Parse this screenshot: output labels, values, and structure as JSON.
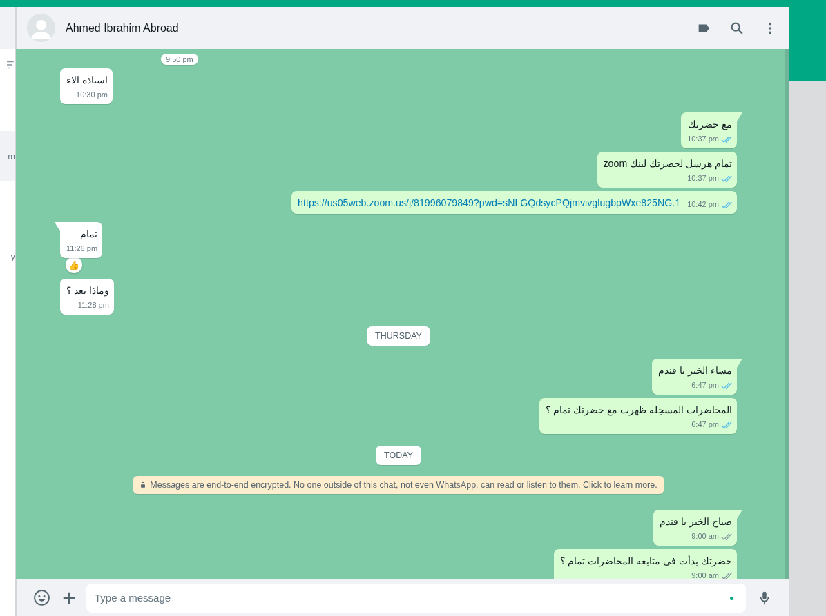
{
  "sidebar": {
    "items": [
      {
        "text": "m",
        "selected": true
      },
      {
        "text": "y",
        "selected": false
      }
    ]
  },
  "chat": {
    "contact_name": "Ahmed Ibrahim Abroad"
  },
  "messages": [
    {
      "kind": "cut",
      "time": "9:50 pm"
    },
    {
      "kind": "in",
      "text": "استاذه الاء",
      "time": "10:30 pm",
      "tail": false,
      "link": false
    },
    {
      "kind": "out",
      "text": "مع حضرتك",
      "time": "10:37 pm",
      "tail": true,
      "link": false,
      "read": true
    },
    {
      "kind": "out",
      "text": "تمام هرسل لحضرتك لينك zoom",
      "time": "10:37 pm",
      "tail": false,
      "link": false,
      "read": true
    },
    {
      "kind": "out",
      "text": "https://us05web.zoom.us/j/81996079849?pwd=sNLGQdsycPQjmvivglugbpWxe825NG.1",
      "time": "10:42 pm",
      "tail": false,
      "link": true,
      "read": true
    },
    {
      "kind": "in",
      "text": "تمام",
      "time": "11:26 pm",
      "tail": true,
      "link": false,
      "reaction": "👍"
    },
    {
      "kind": "in",
      "text": "وماذا بعد ؟",
      "time": "11:28 pm",
      "tail": false,
      "link": false
    },
    {
      "kind": "date",
      "text": "THURSDAY"
    },
    {
      "kind": "out",
      "text": "مساء الخير يا فندم",
      "time": "6:47 pm",
      "tail": true,
      "link": false,
      "read": true
    },
    {
      "kind": "out",
      "text": "المحاضرات المسجله ظهرت مع حضرتك تمام ؟",
      "time": "6:47 pm",
      "tail": false,
      "link": false,
      "read": true
    },
    {
      "kind": "date",
      "text": "TODAY"
    },
    {
      "kind": "system",
      "text": "Messages are end-to-end encrypted. No one outside of this chat, not even WhatsApp, can read or listen to them. Click to learn more."
    },
    {
      "kind": "out",
      "text": "صباح الخير يا فندم",
      "time": "9:00 am",
      "tail": true,
      "link": false,
      "read": false
    },
    {
      "kind": "out",
      "text": "حضرتك بدأت في متابعه المحاضرات تمام ؟",
      "time": "9:00 am",
      "tail": false,
      "link": false,
      "read": false
    }
  ],
  "composer": {
    "placeholder": "Type a message"
  }
}
